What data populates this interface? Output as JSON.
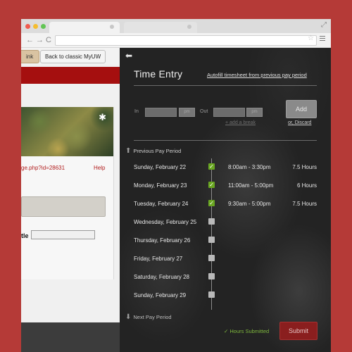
{
  "browser": {
    "tabs": [
      {
        "label": ""
      },
      {
        "label": ""
      }
    ],
    "url": ""
  },
  "page": {
    "partial_button": "ink",
    "classic_button": "Back to classic MyUW",
    "link_text": "ge.php?id=28631",
    "help": "Help",
    "title_label": "tle"
  },
  "panel": {
    "title": "Time Entry",
    "autofill_link": "Autofill timesheet from previous pay period",
    "in_label": "In",
    "out_label": "Out",
    "in_ampm": "pm",
    "out_ampm": "pm",
    "add_break": "+ add a break",
    "add_button": "Add",
    "discard": "or, Discard",
    "prev_period": "Previous Pay Period",
    "next_period": "Next Pay Period",
    "hours_submitted": "✓ Hours Submitted",
    "submit": "Submit",
    "entries": [
      {
        "day": "Sunday, February 22",
        "checked": true,
        "range": "8:00am - 3:30pm",
        "hours": "7.5 Hours"
      },
      {
        "day": "Monday, February 23",
        "checked": true,
        "range": "11:00am - 5:00pm",
        "hours": "6 Hours"
      },
      {
        "day": "Tuesday, February 24",
        "checked": true,
        "range": "9:30am - 5:00pm",
        "hours": "7.5 Hours"
      },
      {
        "day": "Wednesday, February 25",
        "checked": false,
        "range": "",
        "hours": ""
      },
      {
        "day": "Thursday, February 26",
        "checked": false,
        "range": "",
        "hours": ""
      },
      {
        "day": "Friday, February 27",
        "checked": false,
        "range": "",
        "hours": ""
      },
      {
        "day": "Saturday, February 28",
        "checked": false,
        "range": "",
        "hours": ""
      },
      {
        "day": "Sunday, February 29",
        "checked": false,
        "range": "",
        "hours": ""
      }
    ]
  },
  "colors": {
    "background": "#b53a37",
    "uw_red": "#a50f0f",
    "check_green": "#69a621",
    "submit_red": "#8a1e1e"
  }
}
